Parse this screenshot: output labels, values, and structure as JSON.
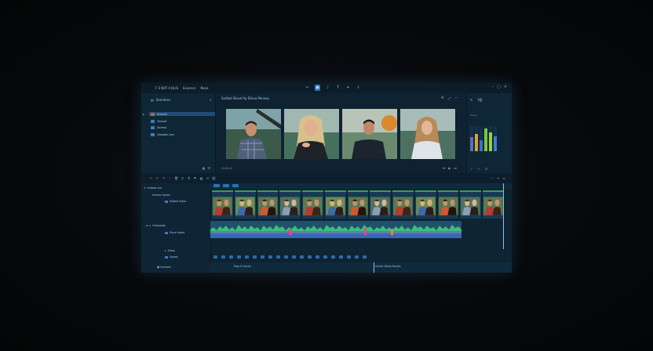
{
  "app": {
    "title": "F S NAT II HLIS",
    "menu": [
      "Eseencs",
      "Nesa"
    ]
  },
  "toolbar": {
    "items": [
      {
        "icon": "cut-icon",
        "label": ""
      },
      {
        "icon": "media-icon",
        "label": "",
        "active": true
      },
      {
        "icon": "audio-icon",
        "label": ""
      },
      {
        "icon": "text-icon",
        "label": ""
      },
      {
        "icon": "effects-icon",
        "label": ""
      },
      {
        "icon": "export-icon",
        "label": ""
      }
    ]
  },
  "left_panel": {
    "header": "Seerdenc",
    "items": [
      {
        "label": "Sheenk",
        "selected": true
      },
      {
        "label": "Tonsod",
        "selected": false
      },
      {
        "label": "Saresd",
        "selected": false
      },
      {
        "label": "Gasaled ans",
        "selected": false
      }
    ]
  },
  "preview": {
    "title": "Sodlod Stoud Ay Ellssa Penoey",
    "timecode": "00:00:00"
  },
  "right_panel": {
    "tab": "ŀģ",
    "label_top": "Ksnes",
    "meters": [
      {
        "color": "#5b6fb8",
        "level": 0.55
      },
      {
        "color": "#d8a03a",
        "level": 0.7
      },
      {
        "color": "#3f6fc0",
        "level": 0.45
      },
      {
        "color": "#7ac63f",
        "level": 0.9
      },
      {
        "color": "#9cd03c",
        "level": 0.75
      },
      {
        "color": "#3e7dd0",
        "level": 0.6
      }
    ]
  },
  "tracks": {
    "headers": [
      {
        "label": "mrdees ssa"
      },
      {
        "label": "Snnesc Sssdrs"
      },
      {
        "label": "Sntkeit Sntee"
      },
      {
        "label": "Frnteslsals"
      },
      {
        "label": "Elsne Ssdod"
      },
      {
        "label": "Shess"
      },
      {
        "label": "Sseses"
      }
    ],
    "clip_count": 13
  },
  "captions": {
    "left": "Psas Si Seshe",
    "right": "Giesta SSeek Bayles"
  },
  "status": {
    "left": "Seelsed"
  },
  "colors": {
    "accent": "#2b72b8",
    "clip_top": "#3e9a5c",
    "audio_wave": "#3fd37a"
  }
}
